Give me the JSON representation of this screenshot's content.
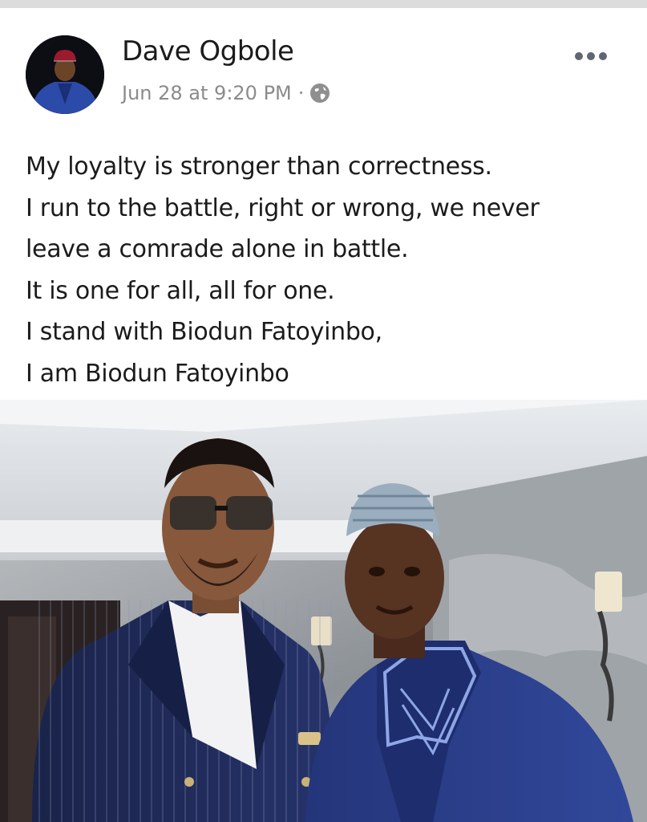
{
  "post": {
    "author": "Dave Ogbole",
    "timestamp": "Jun 28 at 9:20 PM",
    "separator": "·",
    "privacy_icon": "globe-icon",
    "more_icon": "more-options-icon",
    "text_lines": [
      "My loyalty is stronger than correctness.",
      "I run to the battle, right or wrong, we never",
      "leave a comrade alone in battle.",
      "It is one for all, all for one.",
      "I stand with Biodun Fatoyinbo,",
      "I am Biodun Fatoyinbo"
    ]
  },
  "colors": {
    "name_text": "#1b1b1b",
    "meta_text": "#8b8b8b",
    "icon_grey": "#8f8f8f",
    "suit_navy": "#1f2a55",
    "agbada_blue": "#2b3d85"
  }
}
